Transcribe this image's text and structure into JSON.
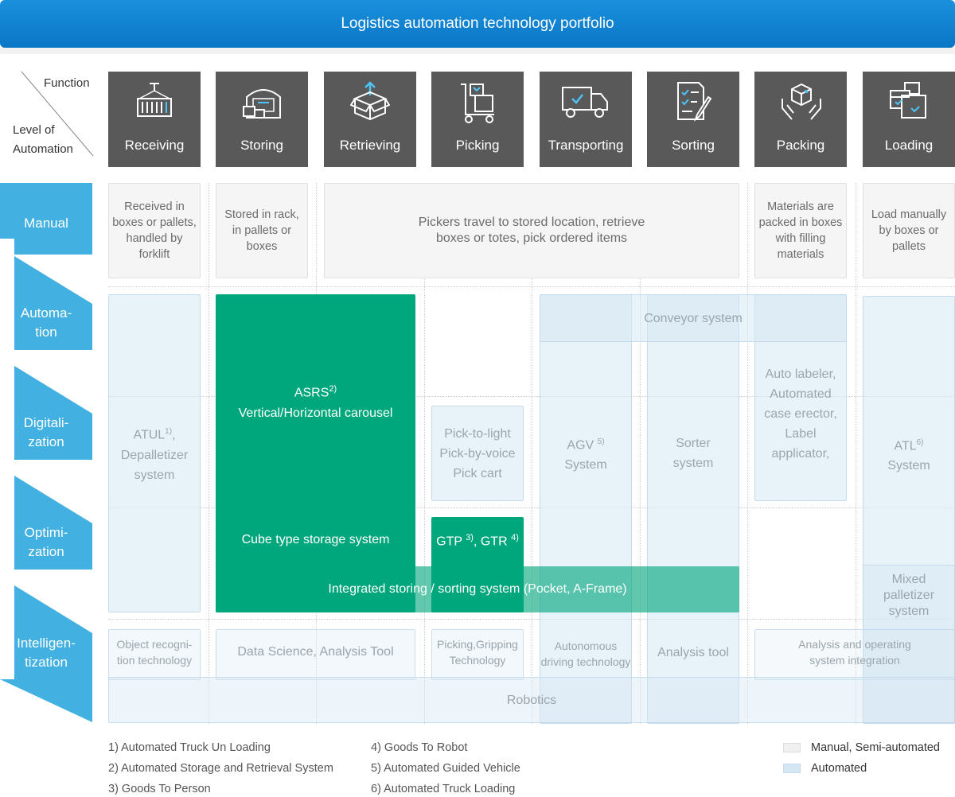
{
  "title": "Logistics automation technology portfolio",
  "corner": {
    "function_label": "Function",
    "level_label_1": "Level of",
    "level_label_2": "Automation"
  },
  "functions": [
    "Receiving",
    "Storing",
    "Retrieving",
    "Picking",
    "Transporting",
    "Sorting",
    "Packing",
    "Loading"
  ],
  "icons": [
    "container-crane-icon",
    "warehouse-icon",
    "open-box-icon",
    "hand-truck-icon",
    "delivery-truck-icon",
    "checklist-icon",
    "box-in-hands-icon",
    "stacked-boxes-icon"
  ],
  "levels": [
    {
      "line1": "Manual",
      "line2": ""
    },
    {
      "line1": "Automa-",
      "line2": "tion"
    },
    {
      "line1": "Digitali-",
      "line2": "zation"
    },
    {
      "line1": "Optimi-",
      "line2": "zation"
    },
    {
      "line1": "Intelligen-",
      "line2": "tization"
    }
  ],
  "manual_row": {
    "receiving": [
      "Received in",
      "boxes or pallets,",
      "handled by",
      "forklift"
    ],
    "storing": [
      "Stored in rack,",
      "in pallets or",
      "boxes"
    ],
    "picking": [
      "Pickers  travel to stored location, retrieve",
      "boxes or totes, pick ordered items"
    ],
    "packing": [
      "Materials are",
      "packed in boxes",
      "with filling",
      "materials"
    ],
    "loading": [
      "Load manually",
      "by boxes or",
      "pallets"
    ]
  },
  "auto_cells": {
    "conveyor": "Conveyor system",
    "atul_main": "ATUL",
    "atul_sup": "1)",
    "atul_tail": ",",
    "depalletizer_1": "Depalletizer",
    "depalletizer_2": "system",
    "pick_1": "Pick-to-light",
    "pick_2": "Pick-by-voice",
    "pick_3": "Pick cart",
    "agv_main": "AGV",
    "agv_sup": "5)",
    "agv_line2": "System",
    "sorter_1": "Sorter",
    "sorter_2": "system",
    "packing_1": "Auto labeler,",
    "packing_2": "Automated",
    "packing_3": "case erector,",
    "packing_4": "Label",
    "packing_5": "applicator,",
    "atl_main": "ATL",
    "atl_sup": "6)",
    "atl_line2": "System",
    "mixed_1": "Mixed",
    "mixed_2": "palletizer",
    "mixed_3": "system"
  },
  "green_cells": {
    "asrs_main": "ASRS",
    "asrs_sup": "2)",
    "asrs_line2": "Vertical/Horizontal carousel",
    "cube": "Cube type storage system",
    "gtp_a": "GTP",
    "gtp_a_sup": "3)",
    "gtp_b": ", GTR",
    "gtp_b_sup": "4)",
    "integrated": "Integrated storing / sorting system (Pocket, A-Frame)"
  },
  "intelligence_row": {
    "object_1": "Object recogni-",
    "object_2": "tion technology",
    "data_science": "Data Science, Analysis Tool",
    "picking_1": "Picking,Gripping",
    "picking_2": "Technology",
    "autonomous_1": "Autonomous",
    "autonomous_2": "driving technology",
    "analysis_tool": "Analysis tool",
    "analysis_op_1": "Analysis and operating",
    "analysis_op_2": "system integration",
    "robotics": "Robotics"
  },
  "footnotes": [
    "1) Automated Truck Un Loading",
    "2) Automated Storage and Retrieval System",
    "3) Goods To Person",
    "4) Goods To Robot",
    "5) Automated Guided Vehicle",
    "6) Automated Truck Loading"
  ],
  "legend": {
    "manual": "Manual, Semi-automated",
    "automated": "Automated"
  },
  "colors": {
    "title_bar": "#0a76c6",
    "level_tab": "#42b0e0",
    "function_box": "#595959",
    "green": "#00a77c",
    "automated_fill": "#d6e7f4",
    "manual_fill": "#f5f5f5"
  }
}
